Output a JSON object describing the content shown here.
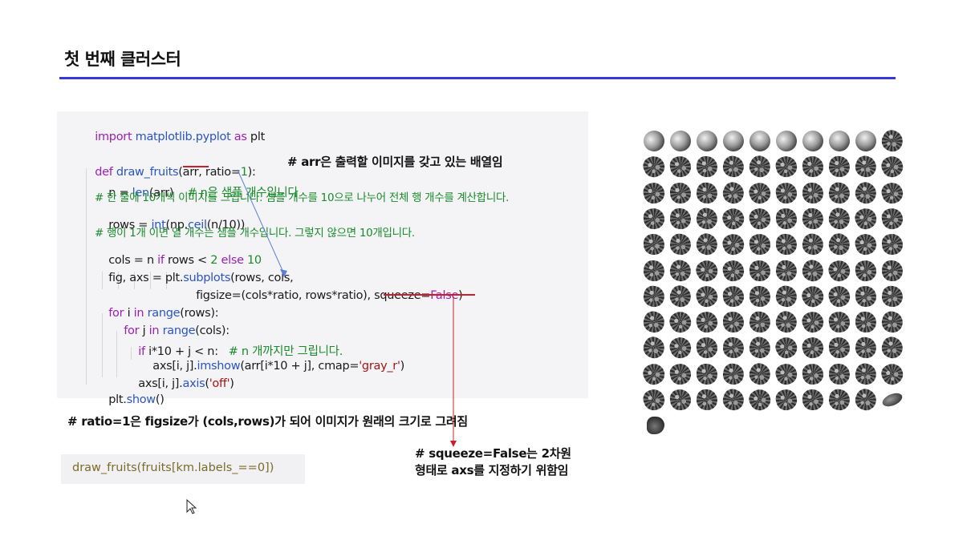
{
  "slide_title": "첫 번째 클러스터",
  "code_lines": {
    "l1": [
      "import",
      " matplotlib.pyplot ",
      "as",
      " plt"
    ],
    "l2_def": "def",
    "l2_fn": " draw_fruits",
    "l2_args": "(arr, ratio=",
    "l2_num": "1",
    "l2_end": "):",
    "l2_comment": "# arr은 출력할 이미지를 갖고 있는 배열임",
    "l3_code": "n = ",
    "l3_fn": "len",
    "l3_rest": "(arr)",
    "l3_comment": "# n은 샘플 개수입니다",
    "l4_comment": "# 한 줄에 10개씩 이미지를 그립니다. 샘플 개수를 10으로 나누어 전체 행 개수를 계산합니다.",
    "l5_a": "rows = ",
    "l5_fn": "int",
    "l5_b": "(np.",
    "l5_fn2": "ceil",
    "l5_c": "(n/10))",
    "l6_comment": "# 행이 1개 이면 열 개수는 샘플 개수입니다. 그렇지 않으면 10개입니다.",
    "l7_a": "cols = n ",
    "l7_kw": "if",
    "l7_b": " rows < ",
    "l7_num": "2",
    "l7_kw2": " else ",
    "l7_num2": "10",
    "l8_a": "fig, axs = plt.",
    "l8_fn": "subplots",
    "l8_b": "(rows, cols,",
    "l9": "figsize=(cols*ratio, rows*ratio), squeeze=",
    "l9_kw": "False",
    "l9_end": ")",
    "l10_kw": "for",
    "l10_a": " i ",
    "l10_kw2": "in",
    "l10_fn": " range",
    "l10_b": "(rows):",
    "l11_kw": "for",
    "l11_a": " j ",
    "l11_kw2": "in",
    "l11_fn": " range",
    "l11_b": "(cols):",
    "l12_kw": "if",
    "l12_a": " i*10 + j < n:",
    "l12_comment": "# n 개까지만 그립니다.",
    "l13_a": "axs[i, j].",
    "l13_fn": "imshow",
    "l13_b": "(arr[i*10 + j], cmap=",
    "l13_st": "'gray_r'",
    "l13_end": ")",
    "l14_a": "axs[i, j].",
    "l14_fn": "axis",
    "l14_b": "(",
    "l14_st": "'off'",
    "l14_end": ")",
    "l15_a": "plt.",
    "l15_fn": "show",
    "l15_b": "()"
  },
  "annotation_ratio": "# ratio=1은 figsize가 (cols,rows)가 되어 이미지가 원래의 크기로 그려짐",
  "annotation_squeeze": "# squeeze=False는 2차원\n형태로 axs를 지정하기 위함임",
  "call_code": "draw_fruits(fruits[km.labels_==0])",
  "fruit_grid": {
    "columns": 10,
    "rows_filled": 11,
    "first_row": [
      "apple",
      "apple",
      "apple",
      "apple",
      "apple",
      "apple",
      "apple",
      "apple",
      "apple",
      "pine"
    ],
    "last_row_types": [
      "pine",
      "pine",
      "pine",
      "pine",
      "pine",
      "pine",
      "pine",
      "pine",
      "pine",
      "banana"
    ],
    "extra": [
      "odd"
    ]
  },
  "colors": {
    "title_rule": "#3838d8",
    "arrow_red": "#c8202a",
    "arrow_blue": "#5a7fd8"
  }
}
